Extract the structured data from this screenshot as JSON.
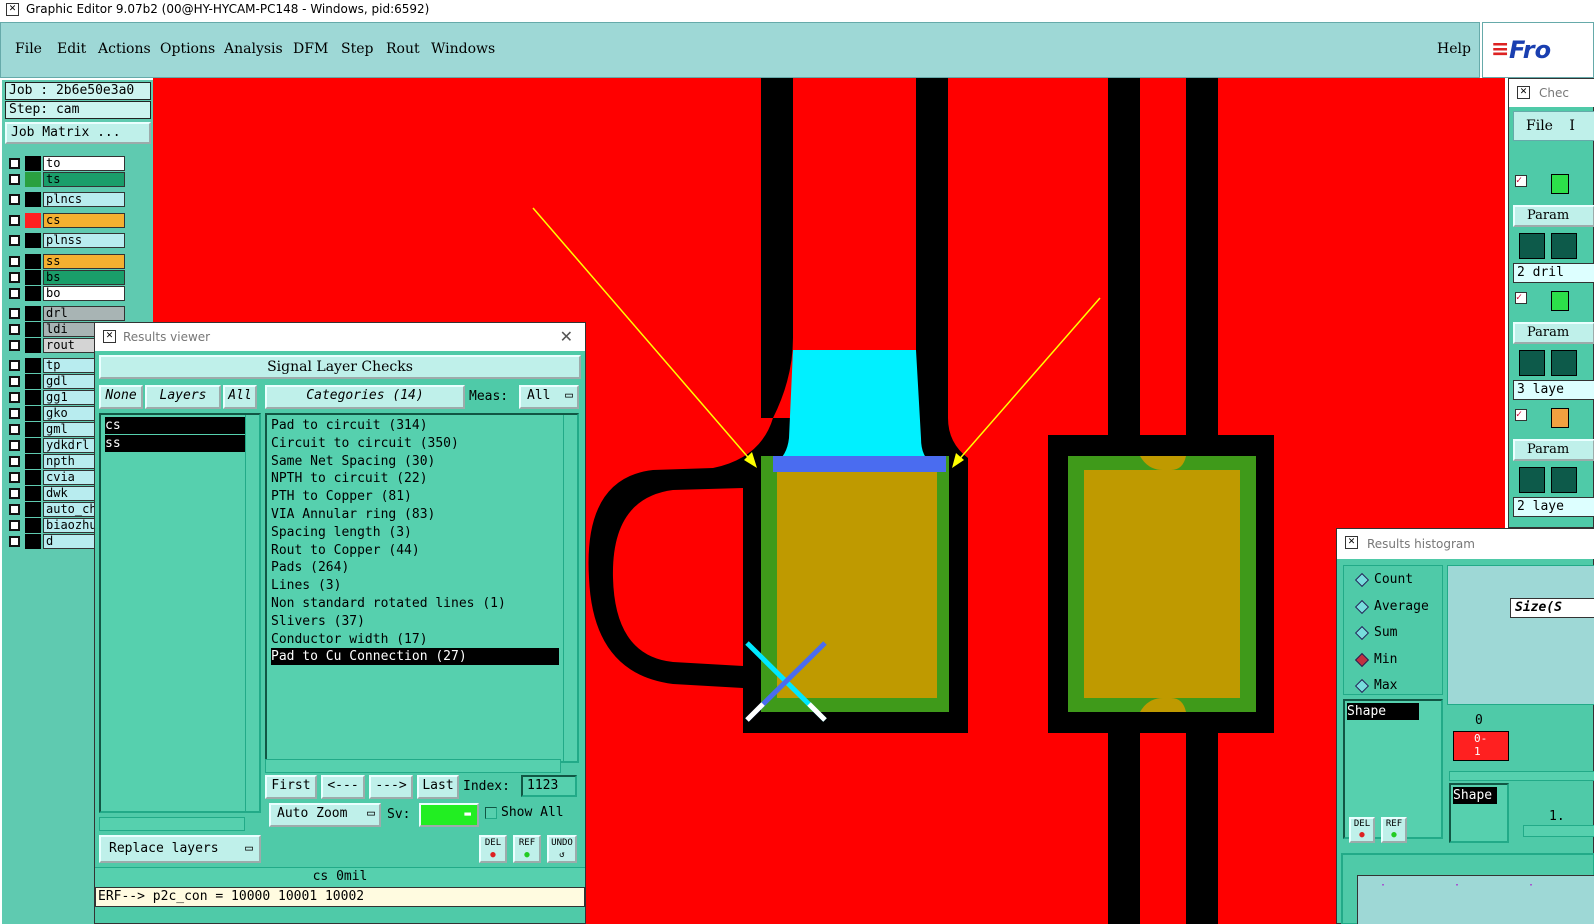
{
  "window": {
    "title": "Graphic Editor 9.07b2 (00@HY-HYCAM-PC148 - Windows, pid:6592)"
  },
  "menu": {
    "items": [
      "File",
      "Edit",
      "Actions",
      "Options",
      "Analysis",
      "DFM",
      "Step",
      "Rout",
      "Windows"
    ],
    "help": "Help",
    "logo_text": "Fro"
  },
  "left_panel": {
    "job": "Job : 2b6e50e3a0",
    "step": "Step: cam",
    "job_matrix": "Job Matrix ...",
    "layers": [
      {
        "name": "to",
        "color": "#ffffff",
        "swatch": "#000000"
      },
      {
        "name": "ts",
        "color": "#1a9e6a",
        "swatch": "#2aa040"
      },
      {
        "name": "plncs",
        "color": "#b8ecef",
        "swatch": "#000000"
      },
      {
        "name": "cs",
        "color": "#f4b030",
        "swatch": "#ff2020"
      },
      {
        "name": "plnss",
        "color": "#b8ecef",
        "swatch": "#000000"
      },
      {
        "name": "ss",
        "color": "#f4b030",
        "swatch": "#000000"
      },
      {
        "name": "bs",
        "color": "#1a9e6a",
        "swatch": "#000000"
      },
      {
        "name": "bo",
        "color": "#ffffff",
        "swatch": "#000000"
      },
      {
        "name": "drl",
        "color": "#a8b4b4",
        "swatch": "#000000"
      },
      {
        "name": "ldi",
        "color": "#a8b4b4",
        "swatch": "#000000"
      },
      {
        "name": "rout",
        "color": "#d4d4d4",
        "swatch": "#000000"
      },
      {
        "name": "tp",
        "color": "#b8ecef",
        "swatch": "#000000"
      },
      {
        "name": "gdl",
        "color": "#b8ecef",
        "swatch": "#000000"
      },
      {
        "name": "gg1",
        "color": "#b8ecef",
        "swatch": "#000000"
      },
      {
        "name": "gko",
        "color": "#b8ecef",
        "swatch": "#000000"
      },
      {
        "name": "gml",
        "color": "#b8ecef",
        "swatch": "#000000"
      },
      {
        "name": "ydkdrl",
        "color": "#b8ecef",
        "swatch": "#000000"
      },
      {
        "name": "npth",
        "color": "#b8ecef",
        "swatch": "#000000"
      },
      {
        "name": "cvia",
        "color": "#b8ecef",
        "swatch": "#000000"
      },
      {
        "name": "dwk",
        "color": "#b8ecef",
        "swatch": "#000000"
      },
      {
        "name": "auto_chk",
        "color": "#b8ecef",
        "swatch": "#000000"
      },
      {
        "name": "biaozhu",
        "color": "#b8ecef",
        "swatch": "#000000"
      },
      {
        "name": "d",
        "color": "#b8ecef",
        "swatch": "#000000"
      }
    ]
  },
  "results_viewer": {
    "title": "Results viewer",
    "header": "Signal Layer Checks",
    "btn_none": "None",
    "btn_layers": "Layers",
    "btn_all": "All",
    "btn_categories": "Categories (14)",
    "meas_label": "Meas:",
    "meas_value": "All",
    "layers": [
      "cs",
      "ss"
    ],
    "categories": [
      "Pad to circuit (314)",
      "Circuit to circuit (350)",
      "Same Net Spacing (30)",
      "NPTH to circuit (22)",
      "PTH to Copper (81)",
      "VIA Annular ring (83)",
      "Spacing length (3)",
      "Rout to Copper (44)",
      "Pads (264)",
      "Lines (3)",
      "Non standard rotated lines (1)",
      "Slivers (37)",
      "Conductor width (17)",
      "Pad to Cu Connection (27)"
    ],
    "selected_category_index": 13,
    "nav_first": "First",
    "nav_prev": "<---",
    "nav_next": "--->",
    "nav_last": "Last",
    "index_label": "Index:",
    "index_value": "1123",
    "auto_zoom": "Auto Zoom",
    "sv_label": "Sv:",
    "show_all": "Show All",
    "replace_layers": "Replace layers",
    "icon_del": "DEL",
    "icon_ref": "REF",
    "icon_undo": "UNDO",
    "status": "cs 0mil",
    "erf_line": "ERF--> p2c_con = 10000 10001 10002"
  },
  "results_histogram": {
    "title": "Results histogram",
    "options": [
      {
        "label": "Count",
        "selected": false
      },
      {
        "label": "Average",
        "selected": false
      },
      {
        "label": "Sum",
        "selected": false
      },
      {
        "label": "Min",
        "selected": true
      },
      {
        "label": "Max",
        "selected": false
      }
    ],
    "size_label": "Size(S",
    "shape_label": "Shape",
    "shape_label2": "Shape",
    "axis_zero": "0",
    "bin_label": "0-\n1",
    "scale_value": "1.",
    "icon_del": "DEL",
    "icon_ref": "REF"
  },
  "checklist": {
    "title": "Chec",
    "file_menu": "File",
    "file_menu_extra": "I",
    "rows": [
      "2 dril",
      "3 laye",
      "2 laye"
    ],
    "param_label": "Param"
  }
}
